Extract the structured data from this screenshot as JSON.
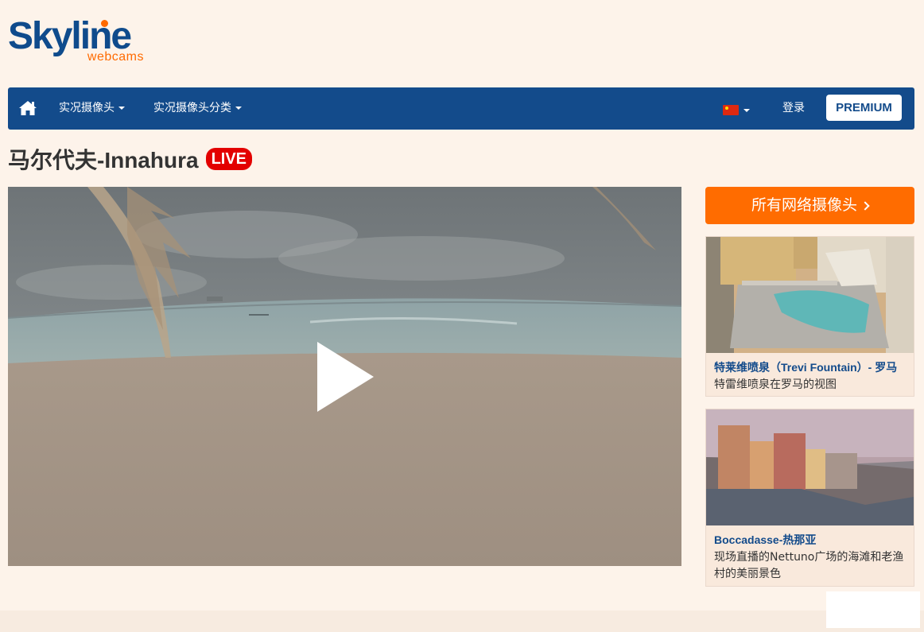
{
  "logo": {
    "main": "Skyline",
    "sub": "webcams"
  },
  "nav": {
    "home_icon": "home-icon",
    "live_cams": "实况摄像头",
    "categories": "实况摄像头分类",
    "language_flag": "china-flag-icon",
    "login": "登录",
    "premium": "PREMIUM"
  },
  "page": {
    "title": "马尔代夫-Innahura",
    "live_badge": "LIVE"
  },
  "player": {
    "play_icon": "play-icon"
  },
  "sidebar": {
    "all_cams": "所有网络摄像头",
    "cards": [
      {
        "title": "特莱维喷泉（Trevi Fountain）- 罗马",
        "desc": "特雷维喷泉在罗马的视图"
      },
      {
        "title": "Boccadasse-热那亚",
        "desc": "现场直播的Nettuno广场的海滩和老渔村的美丽景色"
      }
    ]
  },
  "colors": {
    "brand_blue": "#134b8b",
    "accent_orange": "#ff6c00",
    "live_red": "#e30000",
    "background": "#fdf3ea"
  }
}
